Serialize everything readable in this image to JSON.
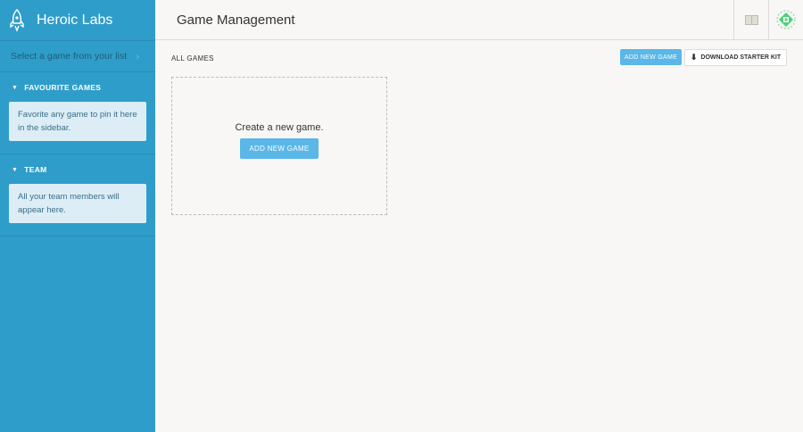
{
  "sidebar": {
    "brand": "Heroic Labs",
    "select_game": "Select a game from your list",
    "favourites": {
      "title": "FAVOURITE GAMES",
      "empty": "Favorite any game to pin it here in the sidebar."
    },
    "team": {
      "title": "TEAM",
      "empty": "All your team members will appear here."
    }
  },
  "header": {
    "title": "Game Management"
  },
  "main": {
    "section_label": "ALL GAMES",
    "add_new_game": "ADD NEW GAME",
    "download_starter_kit": "DOWNLOAD STARTER KIT",
    "empty_text": "Create a new game.",
    "empty_button": "ADD NEW GAME"
  },
  "colors": {
    "sidebar": "#2f9dc9",
    "accent": "#5ab7e8"
  }
}
